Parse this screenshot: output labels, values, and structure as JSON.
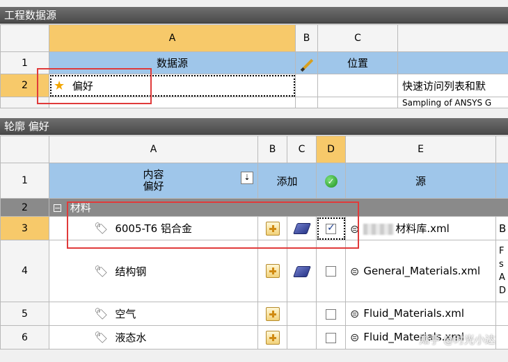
{
  "top_panel": {
    "title": "工程数据源",
    "col_headers": {
      "rownum": "",
      "a": "A",
      "b": "B",
      "c": "C"
    },
    "row1": {
      "rownum": "1",
      "a": "数据源",
      "c": "位置"
    },
    "row2": {
      "rownum": "2",
      "a": "偏好",
      "desc": "快速访问列表和默"
    },
    "row3": {
      "desc": "Sampling of ANSYS G"
    }
  },
  "bottom_panel": {
    "title": "轮廓 偏好",
    "col_headers": {
      "rownum": "",
      "a": "A",
      "b": "B",
      "c": "C",
      "d": "D",
      "e": "E"
    },
    "header_row": {
      "rownum": "1",
      "a1": "内容",
      "a2": "偏好",
      "bc": "添加",
      "e": "源"
    },
    "group": {
      "rownum": "2",
      "label": "材料"
    },
    "rows": [
      {
        "rownum": "3",
        "name": "6005-T6 铝合金",
        "source": "材料库.xml",
        "extra": "B",
        "checked": true
      },
      {
        "rownum": "4",
        "name": "结构钢",
        "source": "General_Materials.xml",
        "extra_lines": [
          "F",
          "s",
          "A",
          "D"
        ],
        "checked": false
      },
      {
        "rownum": "5",
        "name": "空气",
        "source": "Fluid_Materials.xml",
        "checked": false
      },
      {
        "rownum": "6",
        "name": "液态水",
        "source": "Fluid_Materials.xml",
        "checked": false
      }
    ]
  },
  "watermark": "知乎 @时光小达",
  "colors": {
    "title_bar": "#5a5a5a",
    "selected_header": "#f7c96a",
    "blue_header": "#9fc6ea",
    "highlight_box": "#e03a3a"
  }
}
